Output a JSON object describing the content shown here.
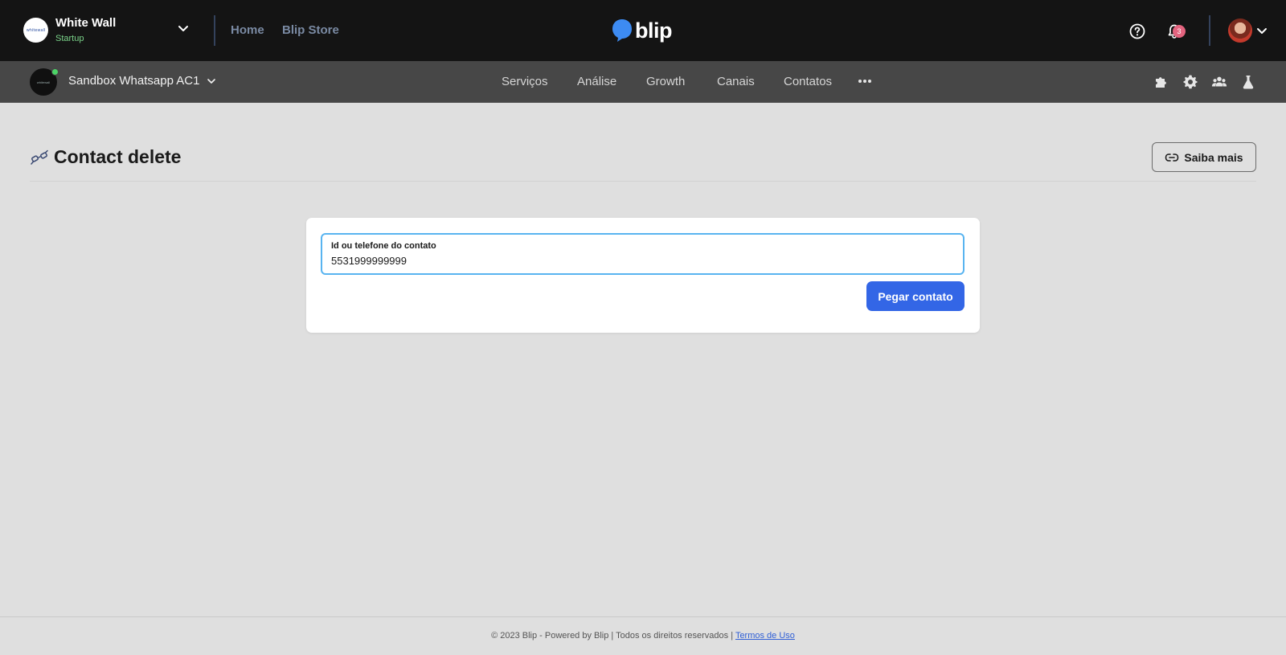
{
  "header": {
    "org_name": "White Wall",
    "org_plan": "Startup",
    "org_logo_text": "whitewall",
    "nav": [
      "Home",
      "Blip Store"
    ],
    "brand": "blip",
    "notification_count": "3",
    "icons": {
      "help": "help-circle-icon",
      "bell": "bell-icon",
      "chevron": "chevron-down-icon"
    }
  },
  "subheader": {
    "bot_name": "Sandbox Whatsapp AC1",
    "bot_avatar_text": "whitewall",
    "status_color": "#4cd467",
    "tabs": [
      "Serviços",
      "Análise",
      "Growth",
      "Canais",
      "Contatos"
    ],
    "icons": [
      "puzzle-icon",
      "gear-icon",
      "team-icon",
      "flask-icon"
    ]
  },
  "page": {
    "title": "Contact delete",
    "help_button": "Saiba mais"
  },
  "form": {
    "field_label": "Id ou telefone do contato",
    "field_value": "5531999999999",
    "submit_label": "Pegar contato"
  },
  "footer": {
    "text": "© 2023 Blip - Powered by Blip | Todos os direitos reservados |",
    "link": "Termos de Uso"
  },
  "colors": {
    "accent": "#3366e6",
    "focus": "#59b4f0",
    "topbar": "#141414",
    "subbar": "#474747",
    "badge": "#e3647f"
  }
}
